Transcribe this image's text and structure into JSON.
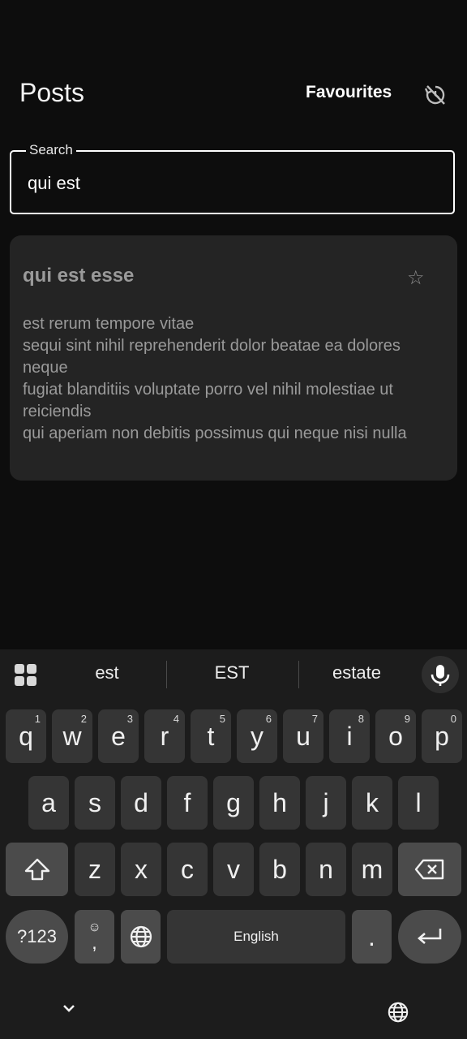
{
  "header": {
    "title": "Posts",
    "favourites_label": "Favourites",
    "history_icon": "history-off-icon"
  },
  "search": {
    "label": "Search",
    "value": "qui est"
  },
  "posts": [
    {
      "title": "qui est esse",
      "favourite": false,
      "body": "est rerum tempore vitae\nsequi sint nihil reprehenderit dolor beatae ea dolores neque\nfugiat blanditiis voluptate porro vel nihil molestiae ut reiciendis\nqui aperiam non debitis possimus qui neque nisi nulla"
    }
  ],
  "keyboard": {
    "suggestions": [
      "est",
      "EST",
      "estate"
    ],
    "row1": [
      {
        "key": "q",
        "hint": "1"
      },
      {
        "key": "w",
        "hint": "2"
      },
      {
        "key": "e",
        "hint": "3"
      },
      {
        "key": "r",
        "hint": "4"
      },
      {
        "key": "t",
        "hint": "5"
      },
      {
        "key": "y",
        "hint": "6"
      },
      {
        "key": "u",
        "hint": "7"
      },
      {
        "key": "i",
        "hint": "8"
      },
      {
        "key": "o",
        "hint": "9"
      },
      {
        "key": "p",
        "hint": "0"
      }
    ],
    "row2": [
      "a",
      "s",
      "d",
      "f",
      "g",
      "h",
      "j",
      "k",
      "l"
    ],
    "row3": [
      "z",
      "x",
      "c",
      "v",
      "b",
      "n",
      "m"
    ],
    "symbols_label": "?123",
    "comma_label": ",",
    "space_label": "English",
    "period_label": "."
  },
  "colors": {
    "background": "#0d0d0d",
    "card": "#242424",
    "keyboard": "#1c1c1c",
    "key": "#353535",
    "key_dark": "#4b4b4b"
  }
}
